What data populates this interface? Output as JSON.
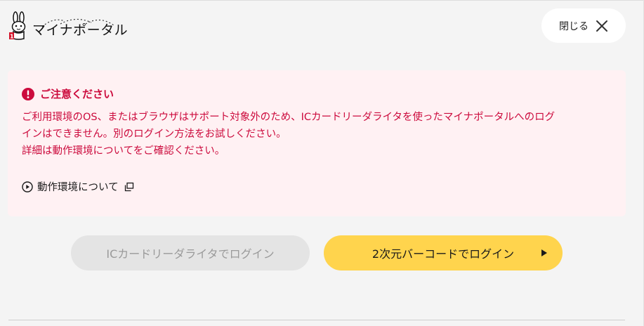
{
  "header": {
    "logo_text": "マイナポータル",
    "close_label": "閉じる"
  },
  "alert": {
    "title": "ご注意ください",
    "body_lines": [
      "ご利用環境のOS、またはブラウザはサポート対象外のため、ICカードリーダライタを使ったマイナポータルへのログ",
      "インはできません。別のログイン方法をお試しください。",
      "詳細は動作環境についてをご確認ください。"
    ],
    "link_label": "動作環境について"
  },
  "buttons": {
    "ic_login": "ICカードリーダライタでログイン",
    "barcode_login": "2次元バーコードでログイン"
  },
  "colors": {
    "alert_text": "#cc0b3d",
    "alert_background": "#fff1f3",
    "primary_button": "#ffd44d",
    "disabled_button": "#e4e4e4"
  },
  "icons": {
    "logo": "mascot-rabbit-icon",
    "close": "close-icon",
    "alert": "exclamation-circle-icon",
    "link": "play-circle-icon",
    "external": "external-window-icon",
    "button_arrow": "triangle-right-icon"
  }
}
